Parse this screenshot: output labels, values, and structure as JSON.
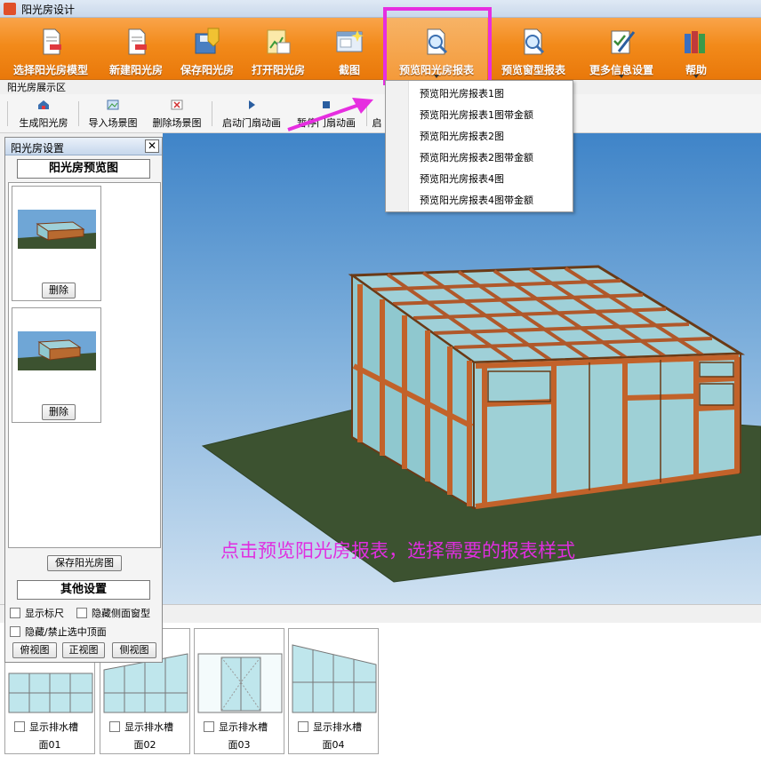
{
  "window": {
    "title": "阳光房设计"
  },
  "ribbon": {
    "buttons": [
      {
        "label": "选择阳光房模型",
        "icon": "document-icon"
      },
      {
        "label": "新建阳光房",
        "icon": "new-document-icon"
      },
      {
        "label": "保存阳光房",
        "icon": "save-icon"
      },
      {
        "label": "打开阳光房",
        "icon": "open-icon"
      },
      {
        "label": "截图",
        "icon": "screenshot-icon"
      },
      {
        "label": "预览阳光房报表",
        "icon": "preview-icon"
      },
      {
        "label": "预览窗型报表",
        "icon": "preview-icon"
      },
      {
        "label": "更多信息设置",
        "icon": "settings-icon"
      },
      {
        "label": "帮助",
        "icon": "books-icon"
      }
    ]
  },
  "section_label": "阳光房展示区",
  "toolbar": {
    "items": [
      {
        "label": "生成阳光房",
        "icon": "house-icon"
      },
      {
        "label": "导入场景图",
        "icon": "import-image-icon"
      },
      {
        "label": "删除场景图",
        "icon": "delete-image-icon"
      },
      {
        "label": "启动门扇动画",
        "icon": "play-icon"
      },
      {
        "label": "暂停门扇动画",
        "icon": "stop-icon"
      },
      {
        "label": "启",
        "icon": "play-icon"
      }
    ]
  },
  "report_menu": {
    "items": [
      "预览阳光房报表1图",
      "预览阳光房报表1图带金额",
      "预览阳光房报表2图",
      "预览阳光房报表2图带金额",
      "预览阳光房报表4图",
      "预览阳光房报表4图带金额"
    ]
  },
  "panel": {
    "title": "阳光房设置",
    "close": "✕",
    "preview_heading": "阳光房预览图",
    "delete_label": "删除",
    "save_button": "保存阳光房图",
    "other_heading": "其他设置",
    "options": {
      "show_ruler": "显示标尺",
      "hide_side_window": "隐藏侧面窗型",
      "hide_top": "隐藏/禁止选中顶面"
    },
    "views": {
      "top": "俯视图",
      "front": "正视图",
      "side": "侧视图"
    }
  },
  "annotation": "点击预览阳光房报表，选择需要的报表样式",
  "faces": [
    {
      "name": "面01",
      "drain_label": "显示排水槽"
    },
    {
      "name": "面02",
      "drain_label": "显示排水槽"
    },
    {
      "name": "面03",
      "drain_label": "显示排水槽"
    },
    {
      "name": "面04",
      "drain_label": "显示排水槽"
    }
  ],
  "colors": {
    "ribbon_orange": "#f28a1a",
    "highlight_magenta": "#e62ee0",
    "annotation_magenta": "#e02ee0",
    "frame_wood": "#c2622a",
    "grass": "#3c5230"
  }
}
